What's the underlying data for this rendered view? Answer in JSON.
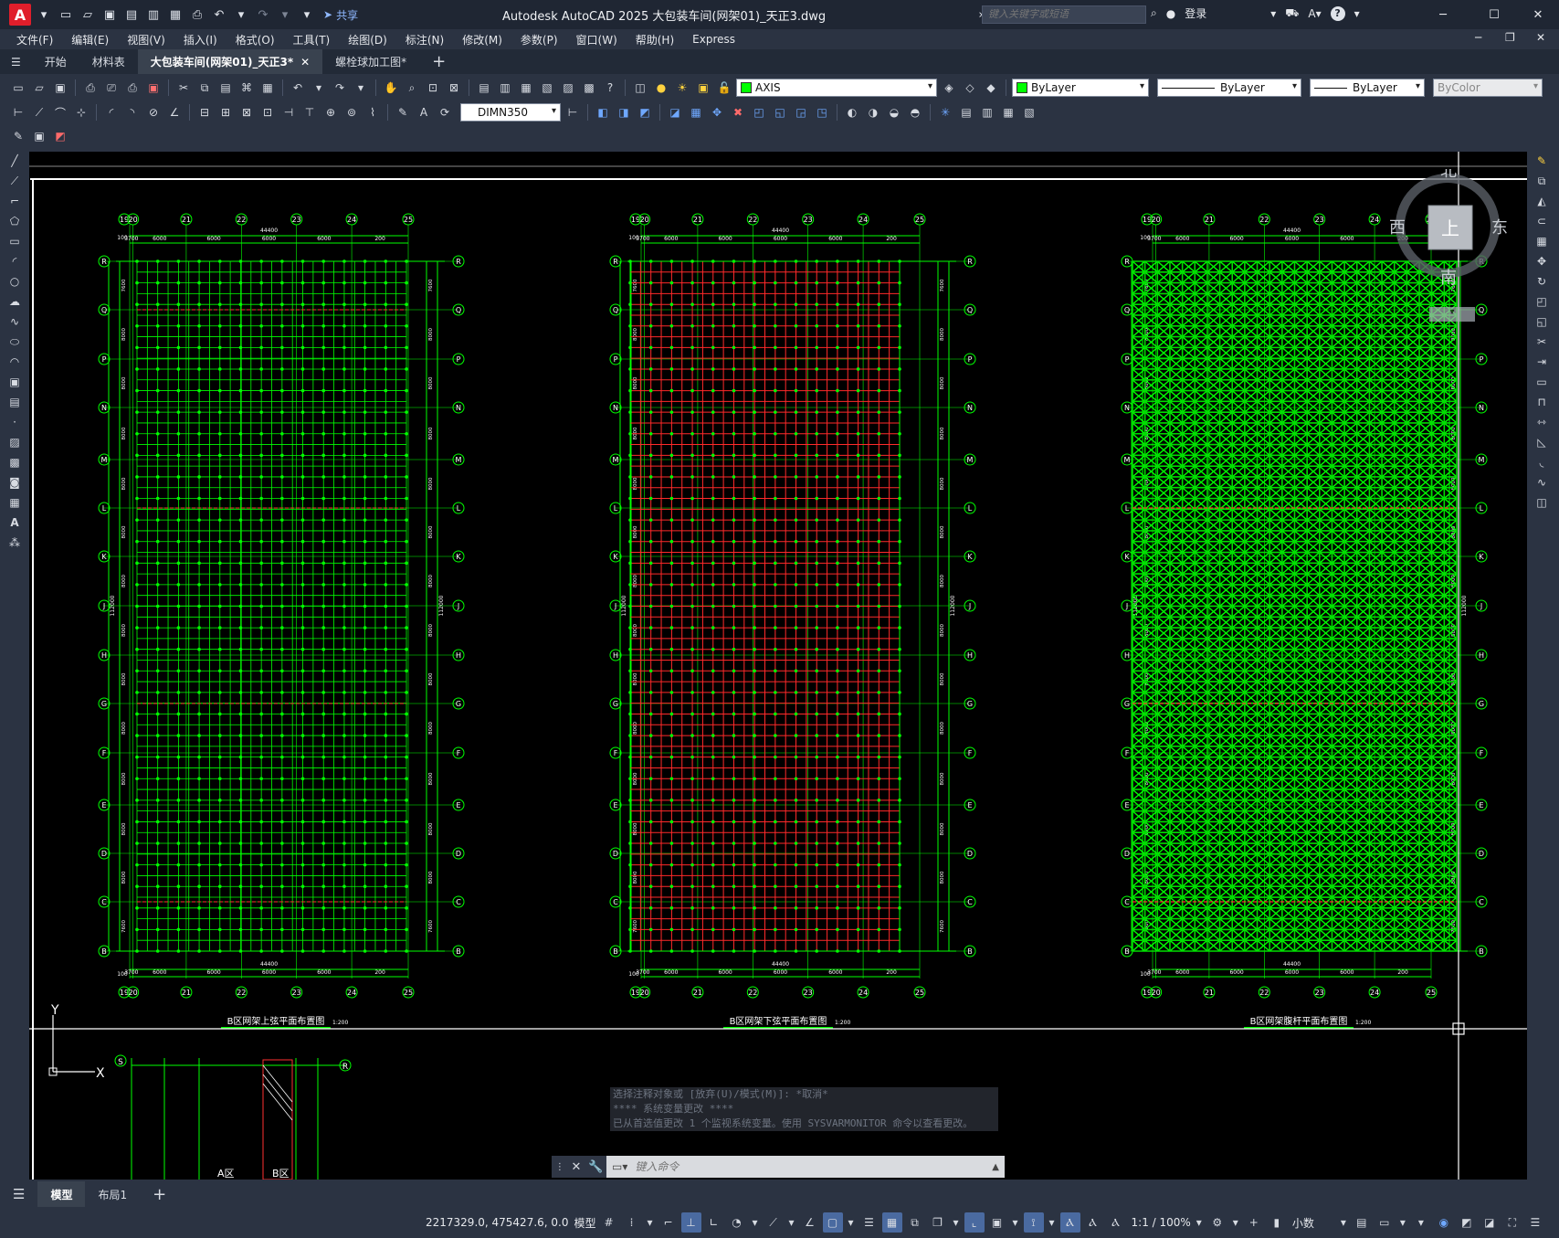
{
  "titlebar": {
    "logo": "A",
    "share_label": "共享",
    "window_title": "Autodesk AutoCAD 2025    大包装车间(网架01)_天正3.dwg",
    "search_placeholder": "键入关键字或短语",
    "login_label": "登录",
    "help_icon": "?"
  },
  "menubar": [
    "文件(F)",
    "编辑(E)",
    "视图(V)",
    "插入(I)",
    "格式(O)",
    "工具(T)",
    "绘图(D)",
    "标注(N)",
    "修改(M)",
    "参数(P)",
    "窗口(W)",
    "帮助(H)",
    "Express"
  ],
  "tabs": [
    {
      "label": "开始",
      "active": false,
      "closable": false
    },
    {
      "label": "材料表",
      "active": false,
      "closable": false
    },
    {
      "label": "大包装车间(网架01)_天正3*",
      "active": true,
      "closable": true
    },
    {
      "label": "螺栓球加工图*",
      "active": false,
      "closable": false
    }
  ],
  "layer_toolbar": {
    "layer_name": "AXIS",
    "layer_color": "#00ff00",
    "color_value": "ByLayer",
    "linetype_value": "ByLayer",
    "lineweight_value": "ByLayer",
    "plotstyle_value": "ByColor"
  },
  "dim_toolbar": {
    "dimstyle_value": "DIMN350"
  },
  "viewcube": {
    "north": "北",
    "south": "南",
    "east": "东",
    "west": "西",
    "top": "上"
  },
  "canvas": {
    "ucs_y": "Y",
    "ucs_x": "X",
    "plans": [
      {
        "title": "B区网架上弦平面布置图",
        "scale": "1:200",
        "style": "upper"
      },
      {
        "title": "B区网架下弦平面布置图",
        "scale": "1:200",
        "style": "lower"
      },
      {
        "title": "B区网架腹杆平面布置图",
        "scale": "1:200",
        "style": "web"
      }
    ],
    "col_axes": [
      "19",
      "20",
      "21",
      "22",
      "23",
      "24",
      "25"
    ],
    "row_axes": [
      "R",
      "Q",
      "P",
      "N",
      "M",
      "L",
      "K",
      "J",
      "H",
      "G",
      "F",
      "E",
      "D",
      "C",
      "B"
    ],
    "col_dims": [
      "3700",
      "6000",
      "6000",
      "6000",
      "6000",
      "200"
    ],
    "total_width": "44400",
    "edge_dim": "100",
    "right_total": "112000",
    "row_dim_labels": [
      "7600",
      "8000",
      "8000",
      "8000",
      "8000",
      "8000",
      "8000",
      "8000",
      "8000",
      "8000",
      "8000",
      "8000",
      "8000",
      "7600"
    ],
    "bottom_partial": {
      "label_a": "A区",
      "label_b": "B区",
      "axis": "R",
      "axis_s": "S"
    }
  },
  "command": {
    "history": [
      "选择注释对象或 [放弃(U)/模式(M)]: *取消*",
      "**** 系统变量更改 ****",
      "已从首选值更改 1 个监视系统变量。使用 SYSVARMONITOR 命令以查看更改。"
    ],
    "input_placeholder": "键入命令"
  },
  "layout_tabs": [
    {
      "label": "模型",
      "active": true
    },
    {
      "label": "布局1",
      "active": false
    }
  ],
  "statusbar": {
    "coords": "2217329.0, 475427.6, 0.0",
    "model_label": "模型",
    "scale_label": "1:1 / 100%",
    "units_label": "小数"
  }
}
